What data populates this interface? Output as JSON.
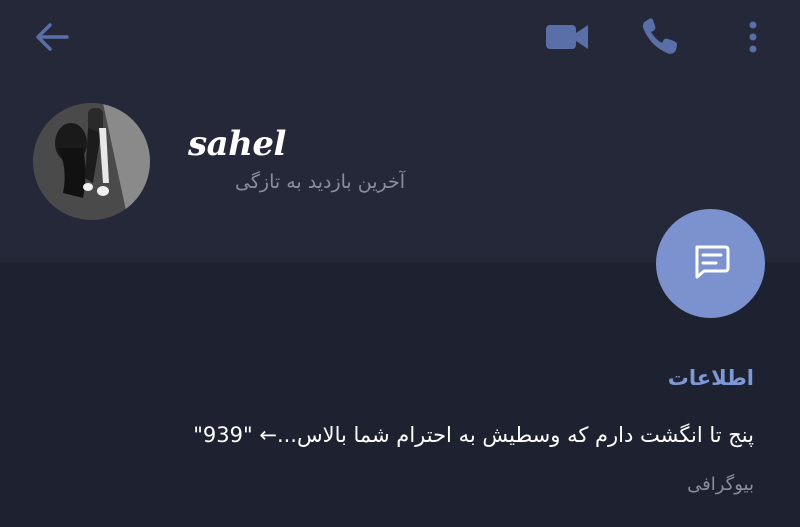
{
  "header": {
    "back_icon": "arrow-left-icon",
    "video_icon": "video-camera-icon",
    "phone_icon": "phone-icon",
    "more_icon": "more-vertical-icon"
  },
  "profile": {
    "name": "sahel",
    "status": "آخرین بازدید به تازگی",
    "avatar": "profile-photo"
  },
  "fab": {
    "icon": "message-icon"
  },
  "info": {
    "title": "اطلاعات",
    "bio": "پنج تا انگشت دارم که وسطیش به احترام شما بالاس...← \"939\"",
    "bio_label": "بیوگرافی"
  },
  "colors": {
    "background": "#1e2130",
    "header_background": "#242838",
    "accent": "#7c92cf",
    "accent_text": "#7d98d6",
    "icon": "#5a6ea8",
    "secondary_text": "#8a8e9c"
  }
}
